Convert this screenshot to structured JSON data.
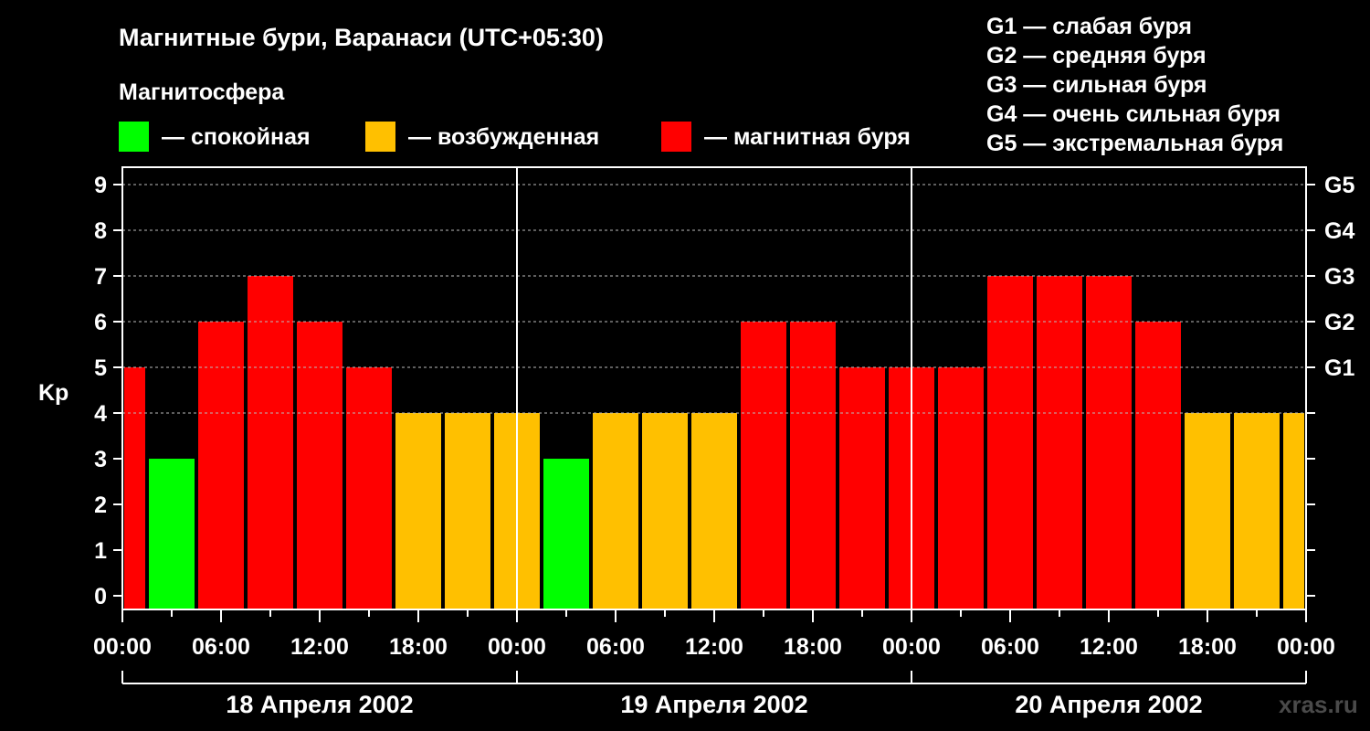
{
  "header": {
    "title": "Магнитные бури, Варанаси (UTC+05:30)",
    "subtitle": "Магнитосфера",
    "watermark": "xras.ru"
  },
  "legend": [
    {
      "label": "— спокойная",
      "color": "#00ff00"
    },
    {
      "label": "— возбужденная",
      "color": "#ffc000"
    },
    {
      "label": "— магнитная буря",
      "color": "#ff0000"
    }
  ],
  "g_legend": [
    "G1 — слабая буря",
    "G2 — средняя буря",
    "G3 — сильная буря",
    "G4 — очень сильная буря",
    "G5 — экстремальная буря"
  ],
  "chart_data": {
    "type": "bar",
    "ylabel": "Kp",
    "ylim": [
      0,
      9
    ],
    "y_ticks": [
      "0",
      "1",
      "2",
      "3",
      "4",
      "5",
      "6",
      "7",
      "8",
      "9"
    ],
    "g_ticks": [
      {
        "kp": 5,
        "label": "G1"
      },
      {
        "kp": 6,
        "label": "G2"
      },
      {
        "kp": 7,
        "label": "G3"
      },
      {
        "kp": 8,
        "label": "G4"
      },
      {
        "kp": 9,
        "label": "G5"
      }
    ],
    "x_tick_labels": [
      "00:00",
      "06:00",
      "12:00",
      "18:00",
      "00:00",
      "06:00",
      "12:00",
      "18:00",
      "00:00",
      "06:00",
      "12:00",
      "18:00",
      "00:00"
    ],
    "days": [
      "18 Апреля 2002",
      "19 Апреля 2002",
      "20 Апреля 2002"
    ],
    "grid": "dashed horizontal",
    "thresholds": {
      "quiet_max": 3,
      "active": 4,
      "storm_min": 5
    },
    "colors": {
      "quiet": "#00ff00",
      "active": "#ffc000",
      "storm": "#ff0000"
    },
    "x_range_hours": [
      0,
      72
    ],
    "bars": [
      {
        "start": -1.5,
        "end": 1.5,
        "kp": 5
      },
      {
        "start": 1.5,
        "end": 4.5,
        "kp": 3
      },
      {
        "start": 4.5,
        "end": 7.5,
        "kp": 6
      },
      {
        "start": 7.5,
        "end": 10.5,
        "kp": 7
      },
      {
        "start": 10.5,
        "end": 13.5,
        "kp": 6
      },
      {
        "start": 13.5,
        "end": 16.5,
        "kp": 5
      },
      {
        "start": 16.5,
        "end": 19.5,
        "kp": 4
      },
      {
        "start": 19.5,
        "end": 22.5,
        "kp": 4
      },
      {
        "start": 22.5,
        "end": 25.5,
        "kp": 4
      },
      {
        "start": 25.5,
        "end": 28.5,
        "kp": 3
      },
      {
        "start": 28.5,
        "end": 31.5,
        "kp": 4
      },
      {
        "start": 31.5,
        "end": 34.5,
        "kp": 4
      },
      {
        "start": 34.5,
        "end": 37.5,
        "kp": 4
      },
      {
        "start": 37.5,
        "end": 40.5,
        "kp": 6
      },
      {
        "start": 40.5,
        "end": 43.5,
        "kp": 6
      },
      {
        "start": 43.5,
        "end": 46.5,
        "kp": 5
      },
      {
        "start": 46.5,
        "end": 49.5,
        "kp": 5
      },
      {
        "start": 49.5,
        "end": 52.5,
        "kp": 5
      },
      {
        "start": 52.5,
        "end": 55.5,
        "kp": 7
      },
      {
        "start": 55.5,
        "end": 58.5,
        "kp": 7
      },
      {
        "start": 58.5,
        "end": 61.5,
        "kp": 7
      },
      {
        "start": 61.5,
        "end": 64.5,
        "kp": 6
      },
      {
        "start": 64.5,
        "end": 67.5,
        "kp": 4
      },
      {
        "start": 67.5,
        "end": 70.5,
        "kp": 4
      },
      {
        "start": 70.5,
        "end": 73.5,
        "kp": 4
      }
    ]
  }
}
